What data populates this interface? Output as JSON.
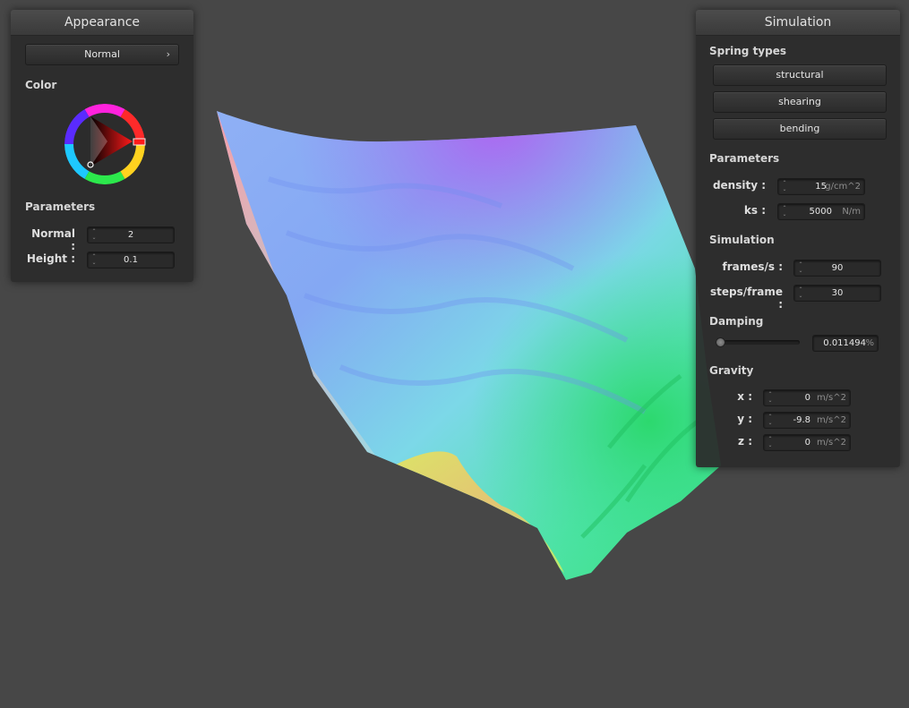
{
  "appearance": {
    "title": "Appearance",
    "shader_label": "Normal",
    "color_section": "Color",
    "params_section": "Parameters",
    "normal_label": "Normal :",
    "normal_value": "2",
    "height_label": "Height :",
    "height_value": "0.1"
  },
  "simulation": {
    "title": "Simulation",
    "spring_section": "Spring types",
    "spring_types": [
      "structural",
      "shearing",
      "bending"
    ],
    "params_section": "Parameters",
    "density_label": "density :",
    "density_value": "15",
    "density_unit": "g/cm^2",
    "ks_label": "ks :",
    "ks_value": "5000",
    "ks_unit": "N/m",
    "sim_section": "Simulation",
    "fps_label": "frames/s :",
    "fps_value": "90",
    "steps_label": "steps/frame :",
    "steps_value": "30",
    "damping_section": "Damping",
    "damping_value": "0.011494",
    "damping_unit": "%",
    "damping_fraction": 0.01,
    "gravity_section": "Gravity",
    "gx_label": "x :",
    "gx_value": "0",
    "gy_label": "y :",
    "gy_value": "-9.8",
    "gz_label": "z :",
    "gz_value": "0",
    "gravity_unit": "m/s^2"
  },
  "colors": {
    "background": "#474747",
    "panel": "#2c2c2c",
    "picked_color": "#ff1a1a"
  },
  "icons": {
    "dropdown": "chevron-right-icon",
    "spinner": "spinner-arrows-icon",
    "color_wheel": "color-wheel-icon"
  }
}
